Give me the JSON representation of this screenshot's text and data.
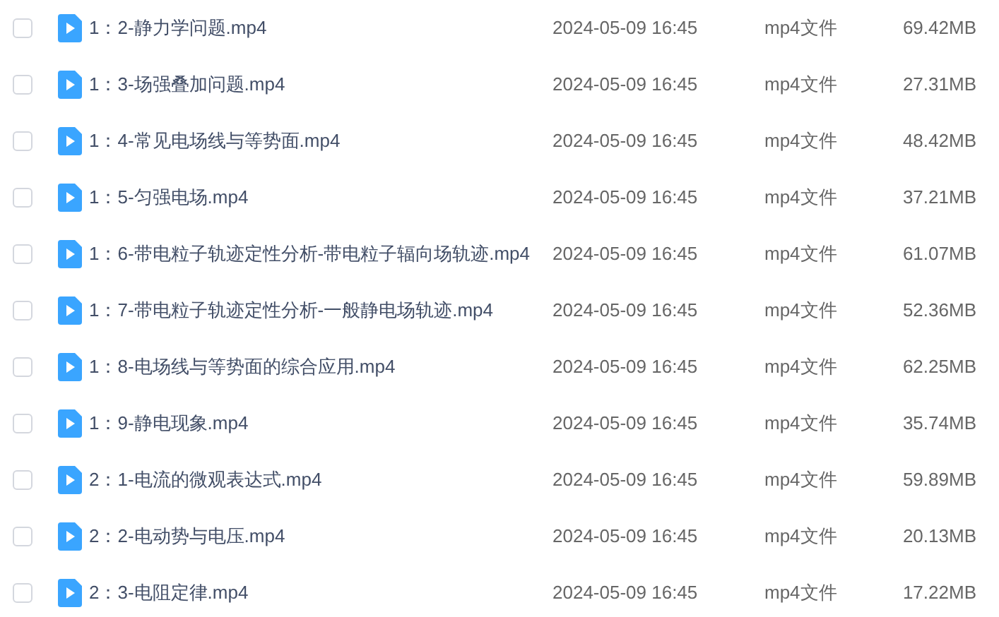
{
  "files": [
    {
      "name": "1：2-静力学问题.mp4",
      "modified": "2024-05-09 16:45",
      "type": "mp4文件",
      "size": "69.42MB",
      "checked": false
    },
    {
      "name": "1：3-场强叠加问题.mp4",
      "modified": "2024-05-09 16:45",
      "type": "mp4文件",
      "size": "27.31MB",
      "checked": false
    },
    {
      "name": "1：4-常见电场线与等势面.mp4",
      "modified": "2024-05-09 16:45",
      "type": "mp4文件",
      "size": "48.42MB",
      "checked": false
    },
    {
      "name": "1：5-匀强电场.mp4",
      "modified": "2024-05-09 16:45",
      "type": "mp4文件",
      "size": "37.21MB",
      "checked": false
    },
    {
      "name": "1：6-带电粒子轨迹定性分析-带电粒子辐向场轨迹.mp4",
      "modified": "2024-05-09 16:45",
      "type": "mp4文件",
      "size": "61.07MB",
      "checked": false
    },
    {
      "name": "1：7-带电粒子轨迹定性分析-一般静电场轨迹.mp4",
      "modified": "2024-05-09 16:45",
      "type": "mp4文件",
      "size": "52.36MB",
      "checked": false
    },
    {
      "name": "1：8-电场线与等势面的综合应用.mp4",
      "modified": "2024-05-09 16:45",
      "type": "mp4文件",
      "size": "62.25MB",
      "checked": false
    },
    {
      "name": "1：9-静电现象.mp4",
      "modified": "2024-05-09 16:45",
      "type": "mp4文件",
      "size": "35.74MB",
      "checked": false
    },
    {
      "name": "2：1-电流的微观表达式.mp4",
      "modified": "2024-05-09 16:45",
      "type": "mp4文件",
      "size": "59.89MB",
      "checked": false
    },
    {
      "name": "2：2-电动势与电压.mp4",
      "modified": "2024-05-09 16:45",
      "type": "mp4文件",
      "size": "20.13MB",
      "checked": false
    },
    {
      "name": "2：3-电阻定律.mp4",
      "modified": "2024-05-09 16:45",
      "type": "mp4文件",
      "size": "17.22MB",
      "checked": false
    }
  ]
}
